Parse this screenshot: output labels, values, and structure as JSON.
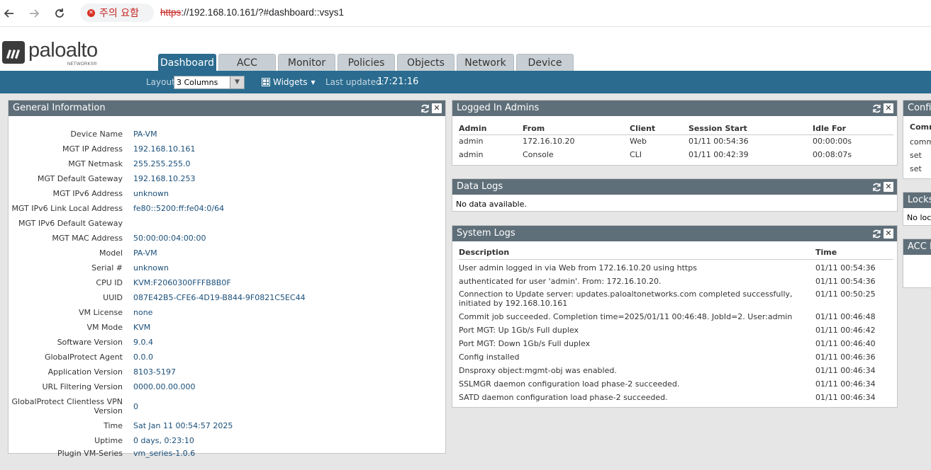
{
  "browser": {
    "warning_label": "주의 요함",
    "url_scheme": "https",
    "url_rest": "://192.168.10.161/?#dashboard::vsys1"
  },
  "brand": {
    "logo_text": "paloalto",
    "logo_sub": "NETWORKS®"
  },
  "tabs": [
    {
      "label": "Dashboard",
      "active": true
    },
    {
      "label": "ACC"
    },
    {
      "label": "Monitor"
    },
    {
      "label": "Policies"
    },
    {
      "label": "Objects"
    },
    {
      "label": "Network"
    },
    {
      "label": "Device"
    }
  ],
  "toolbar": {
    "layout_label": "Layout",
    "layout_value": "3 Columns",
    "widgets_label": "Widgets",
    "last_updated_label": "Last updated:",
    "last_updated_value": "17:21:16"
  },
  "general_info": {
    "title": "General Information",
    "rows": [
      {
        "k": "Device Name",
        "v": "PA-VM"
      },
      {
        "k": "MGT IP Address",
        "v": "192.168.10.161"
      },
      {
        "k": "MGT Netmask",
        "v": "255.255.255.0"
      },
      {
        "k": "MGT Default Gateway",
        "v": "192.168.10.253"
      },
      {
        "k": "MGT IPv6 Address",
        "v": "unknown"
      },
      {
        "k": "MGT IPv6 Link Local Address",
        "v": "fe80::5200:ff:fe04:0/64"
      },
      {
        "k": "MGT IPv6 Default Gateway",
        "v": ""
      },
      {
        "k": "MGT MAC Address",
        "v": "50:00:00:04:00:00"
      },
      {
        "k": "Model",
        "v": "PA-VM"
      },
      {
        "k": "Serial #",
        "v": "unknown"
      },
      {
        "k": "CPU ID",
        "v": "KVM:F2060300FFFB8B0F"
      },
      {
        "k": "UUID",
        "v": "087E42B5-CFE6-4D19-B844-9F0821C5EC44"
      },
      {
        "k": "VM License",
        "v": "none"
      },
      {
        "k": "VM Mode",
        "v": "KVM"
      },
      {
        "k": "Software Version",
        "v": "9.0.4"
      },
      {
        "k": "GlobalProtect Agent",
        "v": "0.0.0"
      },
      {
        "k": "Application Version",
        "v": "8103-5197"
      },
      {
        "k": "URL Filtering Version",
        "v": "0000.00.00.000"
      },
      {
        "k": "GlobalProtect Clientless VPN",
        "k2": "Version",
        "v": "0"
      },
      {
        "k": "Time",
        "v": "Sat Jan 11 00:54:57 2025"
      },
      {
        "k": "Uptime",
        "v": "0 days, 0:23:10"
      },
      {
        "k": "Plugin VM-Series",
        "v": "vm_series-1.0.6"
      }
    ]
  },
  "logged_in_admins": {
    "title": "Logged In Admins",
    "columns": [
      "Admin",
      "From",
      "Client",
      "Session Start",
      "Idle For"
    ],
    "rows": [
      [
        "admin",
        "172.16.10.20",
        "Web",
        "01/11 00:54:36",
        "00:00:00s"
      ],
      [
        "admin",
        "Console",
        "CLI",
        "01/11 00:42:39",
        "00:08:07s"
      ]
    ]
  },
  "data_logs": {
    "title": "Data Logs",
    "empty": "No data available."
  },
  "system_logs": {
    "title": "System Logs",
    "columns": [
      "Description",
      "Time"
    ],
    "rows": [
      [
        "User admin logged in via Web from 172.16.10.20 using https",
        "01/11 00:54:36"
      ],
      [
        "authenticated for user 'admin'. From: 172.16.10.20.",
        "01/11 00:54:36"
      ],
      [
        "Connection to Update server: updates.paloaltonetworks.com completed successfully,\ninitiated by 192.168.10.161",
        "01/11 00:50:25"
      ],
      [
        "Commit job succeeded. Completion time=2025/01/11 00:46:48. JobId=2. User:admin",
        "01/11 00:46:48"
      ],
      [
        "Port MGT: Up 1Gb/s Full duplex",
        "01/11 00:46:42"
      ],
      [
        "Port MGT: Down 1Gb/s Full duplex",
        "01/11 00:46:40"
      ],
      [
        "Config installed",
        "01/11 00:46:36"
      ],
      [
        "Dnsproxy object:mgmt-obj was enabled.",
        "01/11 00:46:34"
      ],
      [
        "SSLMGR daemon configuration load phase-2 succeeded.",
        "01/11 00:46:34"
      ],
      [
        "SATD daemon configuration load phase-2 succeeded.",
        "01/11 00:46:34"
      ]
    ]
  },
  "config_logs": {
    "title": "Config",
    "col": "Comm",
    "rows": [
      "comm",
      "set",
      "set"
    ]
  },
  "locks": {
    "title": "Locks",
    "empty": "No lock"
  },
  "acc_risk": {
    "title": "ACC R"
  }
}
